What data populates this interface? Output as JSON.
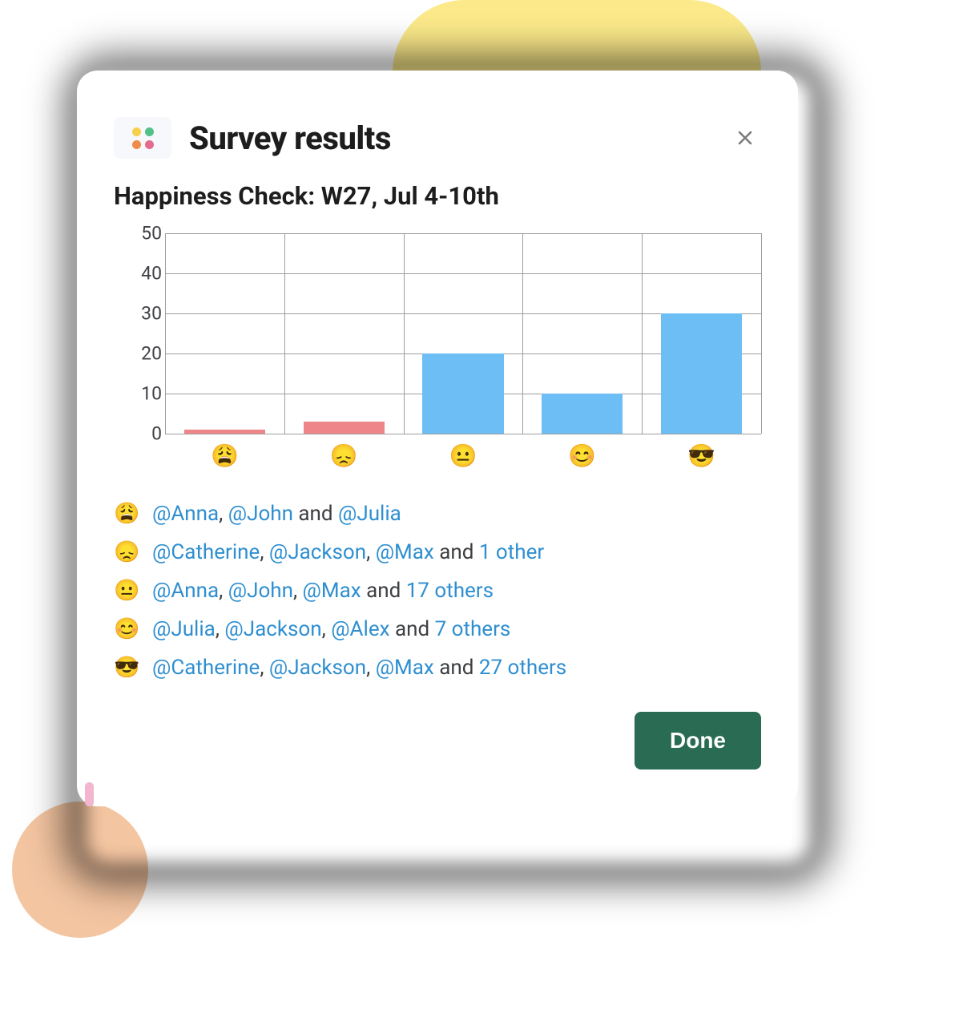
{
  "header": {
    "title": "Survey results",
    "close_aria": "Close"
  },
  "subtitle": "Happiness Check: W27, Jul 4-10th",
  "chart_data": {
    "type": "bar",
    "title": "Happiness Check: W27, Jul 4-10th",
    "xlabel": "",
    "ylabel": "",
    "ylim": [
      0,
      50
    ],
    "yticks": [
      0,
      10,
      20,
      30,
      40,
      50
    ],
    "categories": [
      "😩",
      "😞",
      "😐",
      "😊",
      "😎"
    ],
    "values": [
      1,
      3,
      20,
      10,
      30
    ],
    "colors": [
      "#ee8589",
      "#ee8589",
      "#6cbef4",
      "#6cbef4",
      "#6cbef4"
    ]
  },
  "answers": [
    {
      "emoji": "😩",
      "parts": [
        {
          "type": "mention",
          "text": "@Anna"
        },
        {
          "type": "sep",
          "text": ", "
        },
        {
          "type": "mention",
          "text": "@John"
        },
        {
          "type": "sep",
          "text": " and "
        },
        {
          "type": "mention",
          "text": "@Julia"
        }
      ]
    },
    {
      "emoji": "😞",
      "parts": [
        {
          "type": "mention",
          "text": "@Catherine"
        },
        {
          "type": "sep",
          "text": ", "
        },
        {
          "type": "mention",
          "text": "@Jackson"
        },
        {
          "type": "sep",
          "text": ", "
        },
        {
          "type": "mention",
          "text": "@Max"
        },
        {
          "type": "sep",
          "text": " and "
        },
        {
          "type": "mention",
          "text": "1 other"
        }
      ]
    },
    {
      "emoji": "😐",
      "parts": [
        {
          "type": "mention",
          "text": "@Anna"
        },
        {
          "type": "sep",
          "text": ", "
        },
        {
          "type": "mention",
          "text": "@John"
        },
        {
          "type": "sep",
          "text": ", "
        },
        {
          "type": "mention",
          "text": "@Max"
        },
        {
          "type": "sep",
          "text": " and "
        },
        {
          "type": "mention",
          "text": "17 others"
        }
      ]
    },
    {
      "emoji": "😊",
      "parts": [
        {
          "type": "mention",
          "text": "@Julia"
        },
        {
          "type": "sep",
          "text": ", "
        },
        {
          "type": "mention",
          "text": "@Jackson"
        },
        {
          "type": "sep",
          "text": ", "
        },
        {
          "type": "mention",
          "text": "@Alex"
        },
        {
          "type": "sep",
          "text": " and "
        },
        {
          "type": "mention",
          "text": "7 others"
        }
      ]
    },
    {
      "emoji": "😎",
      "parts": [
        {
          "type": "mention",
          "text": "@Catherine"
        },
        {
          "type": "sep",
          "text": ", "
        },
        {
          "type": "mention",
          "text": "@Jackson"
        },
        {
          "type": "sep",
          "text": ", "
        },
        {
          "type": "mention",
          "text": "@Max"
        },
        {
          "type": "sep",
          "text": " and "
        },
        {
          "type": "mention",
          "text": "27 others"
        }
      ]
    }
  ],
  "footer": {
    "done_label": "Done"
  },
  "colors": {
    "accent": "#296b53",
    "mention": "#2f8fd0"
  }
}
